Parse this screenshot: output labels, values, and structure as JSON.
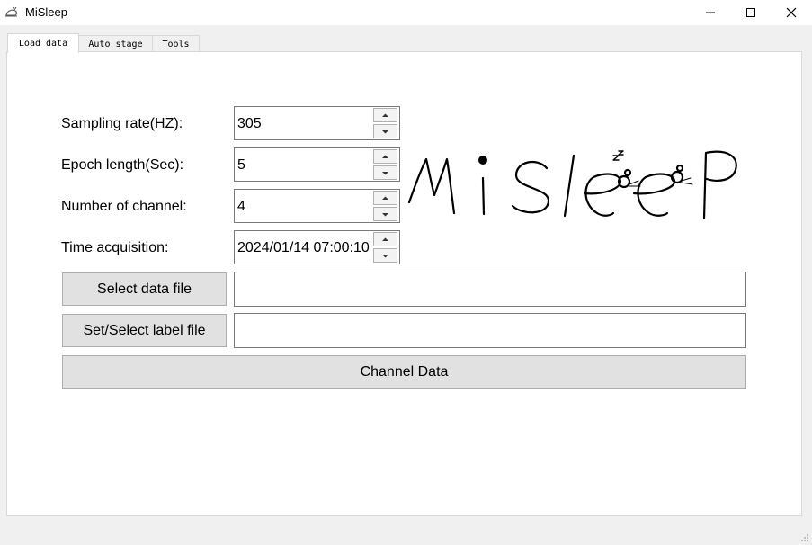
{
  "window": {
    "title": "MiSleep"
  },
  "tabs": [
    {
      "label": "Load data"
    },
    {
      "label": "Auto stage"
    },
    {
      "label": "Tools"
    }
  ],
  "form": {
    "sampling_rate": {
      "label": "Sampling rate(HZ):",
      "value": "305"
    },
    "epoch_length": {
      "label": "Epoch length(Sec):",
      "value": "5"
    },
    "channels": {
      "label": "Number of channel:",
      "value": "4"
    },
    "time_acquisition": {
      "label": "Time acquisition:",
      "value": "2024/01/14 07:00:10"
    }
  },
  "buttons": {
    "select_data": "Select data file",
    "select_label": "Set/Select label file",
    "channel_data": "Channel Data"
  },
  "inputs": {
    "data_file": "",
    "label_file": ""
  }
}
